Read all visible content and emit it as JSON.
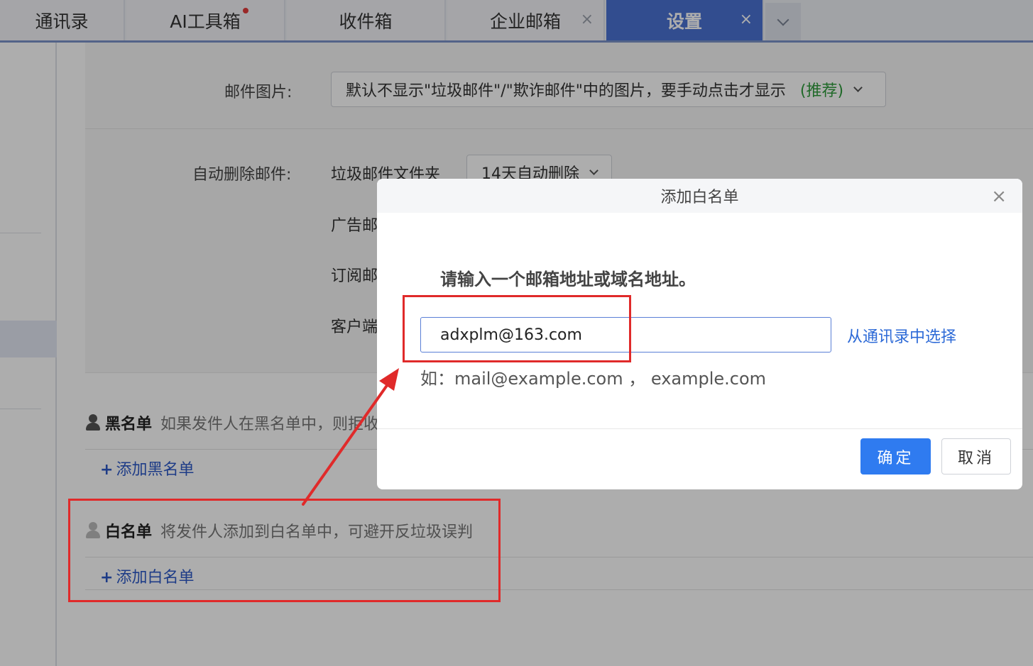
{
  "tabs": [
    {
      "label": "通讯录"
    },
    {
      "label": "AI工具箱",
      "badge": "red-dot"
    },
    {
      "label": "收件箱"
    },
    {
      "label": "企业邮箱",
      "close": "×"
    },
    {
      "label": "设置",
      "close": "×",
      "active": true
    }
  ],
  "settings": {
    "mail_images": {
      "label": "邮件图片:",
      "value": "默认不显示\"垃圾邮件\"/\"欺诈邮件\"中的图片，要手动点击才显示",
      "tag": "(推荐)"
    },
    "auto_delete": {
      "label": "自动删除邮件:",
      "spam_folder": "垃圾邮件文件夹",
      "spam_value": "14天自动删除",
      "row2": "广告邮",
      "row3": "订阅邮",
      "row4": "客户端"
    },
    "blacklist": {
      "title": "黑名单",
      "desc": "如果发件人在黑名单中，则拒收",
      "add": "添加黑名单"
    },
    "whitelist": {
      "title": "白名单",
      "desc": "将发件人添加到白名单中，可避开反垃圾误判",
      "add": "添加白名单"
    }
  },
  "dialog": {
    "title": "添加白名单",
    "close": "×",
    "prompt": "请输入一个邮箱地址或域名地址。",
    "input_value": "adxplm@163.com",
    "pick_from_contacts": "从通讯录中选择",
    "example": "如：mail@example.com ， example.com",
    "ok": "确定",
    "cancel": "取消"
  },
  "colors": {
    "accent": "#4a72d3",
    "primary_button": "#2f7bf0",
    "annotation": "#e02a2a",
    "recommend": "#2f9b3c"
  }
}
